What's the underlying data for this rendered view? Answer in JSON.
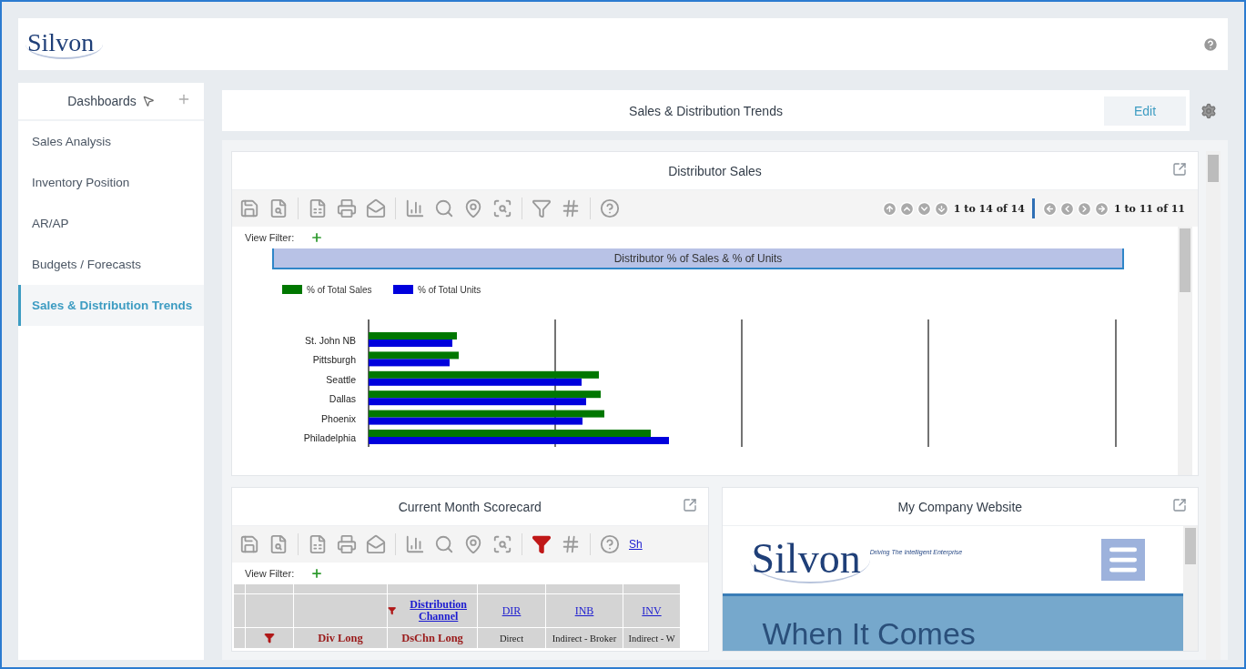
{
  "header": {
    "logo": "Silvon"
  },
  "sidebar": {
    "title": "Dashboards",
    "items": [
      {
        "label": "Sales Analysis",
        "selected": false
      },
      {
        "label": "Inventory Position",
        "selected": false
      },
      {
        "label": "AR/AP",
        "selected": false
      },
      {
        "label": "Budgets / Forecasts",
        "selected": false
      },
      {
        "label": "Sales & Distribution Trends",
        "selected": true
      }
    ]
  },
  "dashboard": {
    "title": "Sales & Distribution Trends",
    "edit_button": "Edit"
  },
  "distributor_panel": {
    "title": "Distributor Sales",
    "filter_active": false,
    "pagers": [
      "1 to 14 of 14",
      "1 to 11 of 11"
    ],
    "view_filter_label": "View Filter:",
    "chart": {
      "title": "Distributor % of Sales & % of Units",
      "legend": [
        {
          "name": "% of Total Sales",
          "color": "#007700"
        },
        {
          "name": "% of Total Units",
          "color": "#0000dd"
        }
      ],
      "categories": [
        "St. John NB",
        "Pittsburgh",
        "Seattle",
        "Dallas",
        "Phoenix",
        "Philadelphia"
      ]
    }
  },
  "scorecard_panel": {
    "title": "Current Month Scorecard",
    "filter_active": true,
    "toolbar_link": "Sh",
    "view_filter_label": "View Filter:",
    "table": {
      "header_cells": [
        "Distribution Channel",
        "DIR",
        "INB",
        "INV"
      ],
      "row_cells": [
        "Div Long",
        "DsChn Long",
        "Direct",
        "Indirect - Broker",
        "Indirect - W"
      ]
    }
  },
  "website_panel": {
    "title": "My Company Website",
    "logo": "Silvon",
    "tagline": "Driving The Intelligent Enterprise",
    "headline": "When It Comes"
  }
}
